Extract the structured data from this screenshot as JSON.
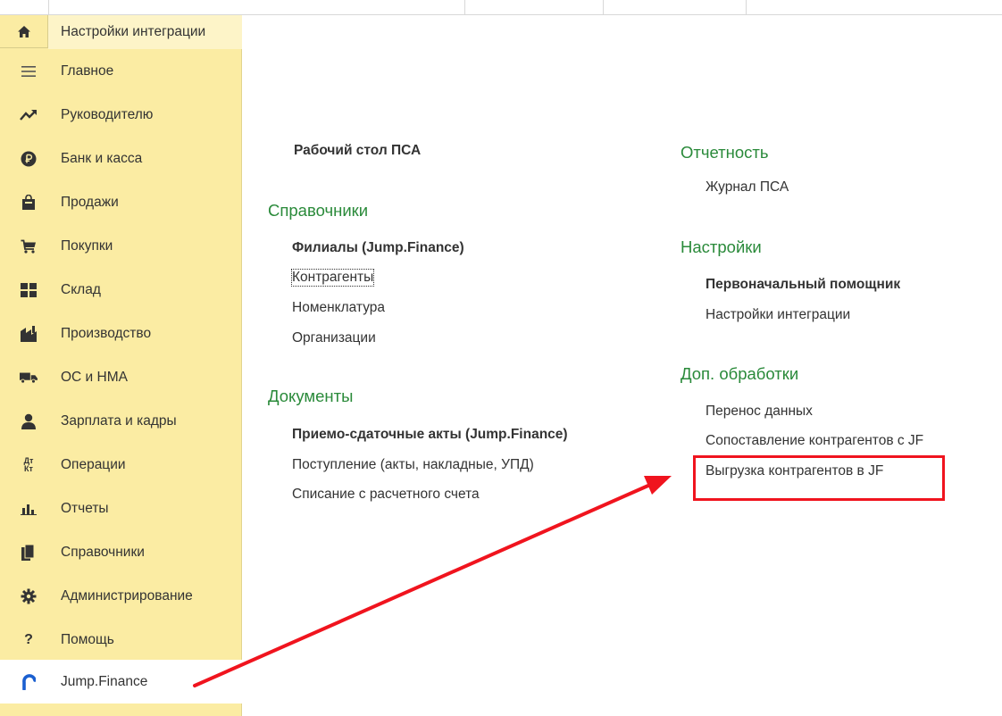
{
  "sidebar": {
    "active_tab": "Настройки интеграции",
    "items": [
      {
        "label": "Главное",
        "icon": "menu-lines-icon"
      },
      {
        "label": "Руководителю",
        "icon": "trend-chart-icon"
      },
      {
        "label": "Банк и касса",
        "icon": "ruble-coin-icon"
      },
      {
        "label": "Продажи",
        "icon": "shopping-bag-icon"
      },
      {
        "label": "Покупки",
        "icon": "shopping-cart-icon"
      },
      {
        "label": "Склад",
        "icon": "warehouse-grid-icon"
      },
      {
        "label": "Производство",
        "icon": "factory-icon"
      },
      {
        "label": "ОС и НМА",
        "icon": "truck-icon"
      },
      {
        "label": "Зарплата и кадры",
        "icon": "person-icon"
      },
      {
        "label": "Операции",
        "icon": "debit-credit-icon",
        "icon_text": "Дт Кт"
      },
      {
        "label": "Отчеты",
        "icon": "bar-chart-icon"
      },
      {
        "label": "Справочники",
        "icon": "books-icon"
      },
      {
        "label": "Администрирование",
        "icon": "gear-icon"
      },
      {
        "label": "Помощь",
        "icon": "question-icon",
        "icon_text": "?"
      },
      {
        "label": "Jump.Finance",
        "icon": "jump-finance-logo-icon"
      }
    ]
  },
  "main": {
    "left": {
      "desktop_link": "Рабочий стол ПСА",
      "directories_title": "Справочники",
      "directories": [
        "Филиалы (Jump.Finance)",
        "Контрагенты",
        "Номенклатура",
        "Организации"
      ],
      "documents_title": "Документы",
      "documents": [
        "Приемо-сдаточные акты (Jump.Finance)",
        "Поступление (акты, накладные, УПД)",
        "Списание с расчетного счета"
      ]
    },
    "right": {
      "reports_title": "Отчетность",
      "reports": [
        "Журнал ПСА"
      ],
      "settings_title": "Настройки",
      "settings": [
        "Первоначальный помощник",
        "Настройки интеграции"
      ],
      "extra_title": "Доп. обработки",
      "extra": [
        "Перенос данных",
        "Сопоставление контрагентов с JF",
        "Выгрузка контрагентов в JF"
      ]
    }
  },
  "colors": {
    "sidebar_bg": "#fbeca3",
    "section_title": "#2a8a3a",
    "annotation_red": "#f0141e",
    "logo_blue": "#1a5fd0"
  }
}
